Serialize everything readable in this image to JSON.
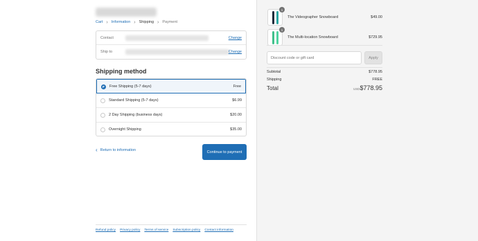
{
  "breadcrumb": [
    {
      "label": "Cart"
    },
    {
      "label": "Information"
    },
    {
      "label": "Shipping"
    },
    {
      "label": "Payment"
    }
  ],
  "review": {
    "contact_label": "Contact",
    "shipto_label": "Ship to",
    "change_label": "Change"
  },
  "shipping": {
    "title": "Shipping method",
    "options": [
      {
        "name": "Free Shipping (5-7 days)",
        "price": "Free",
        "selected": true
      },
      {
        "name": "Standard Shipping (5-7 days)",
        "price": "$6.99",
        "selected": false
      },
      {
        "name": "2 Day Shipping (business days)",
        "price": "$20.00",
        "selected": false
      },
      {
        "name": "Overnight Shipping",
        "price": "$35.00",
        "selected": false
      }
    ]
  },
  "actions": {
    "return_label": "Return to information",
    "continue_label": "Continue to payment"
  },
  "footer": {
    "links": [
      "Refund policy",
      "Privacy policy",
      "Terms of service",
      "Subscription policy",
      "Contact information"
    ]
  },
  "cart": {
    "items": [
      {
        "title": "The Videographer Snowboard",
        "price": "$49.00",
        "qty": "1"
      },
      {
        "title": "The Multi-location Snowboard",
        "price": "$729.95",
        "qty": "1"
      }
    ],
    "discount_placeholder": "Discount code or gift card",
    "apply_label": "Apply",
    "subtotal_label": "Subtotal",
    "subtotal_value": "$778.95",
    "shipping_label": "Shipping",
    "shipping_value": "FREE",
    "total_label": "Total",
    "total_currency": "USD",
    "total_value": "$778.95"
  },
  "colors": {
    "accent": "#1f6eb5",
    "sidebar_bg": "#f4f4f4"
  }
}
